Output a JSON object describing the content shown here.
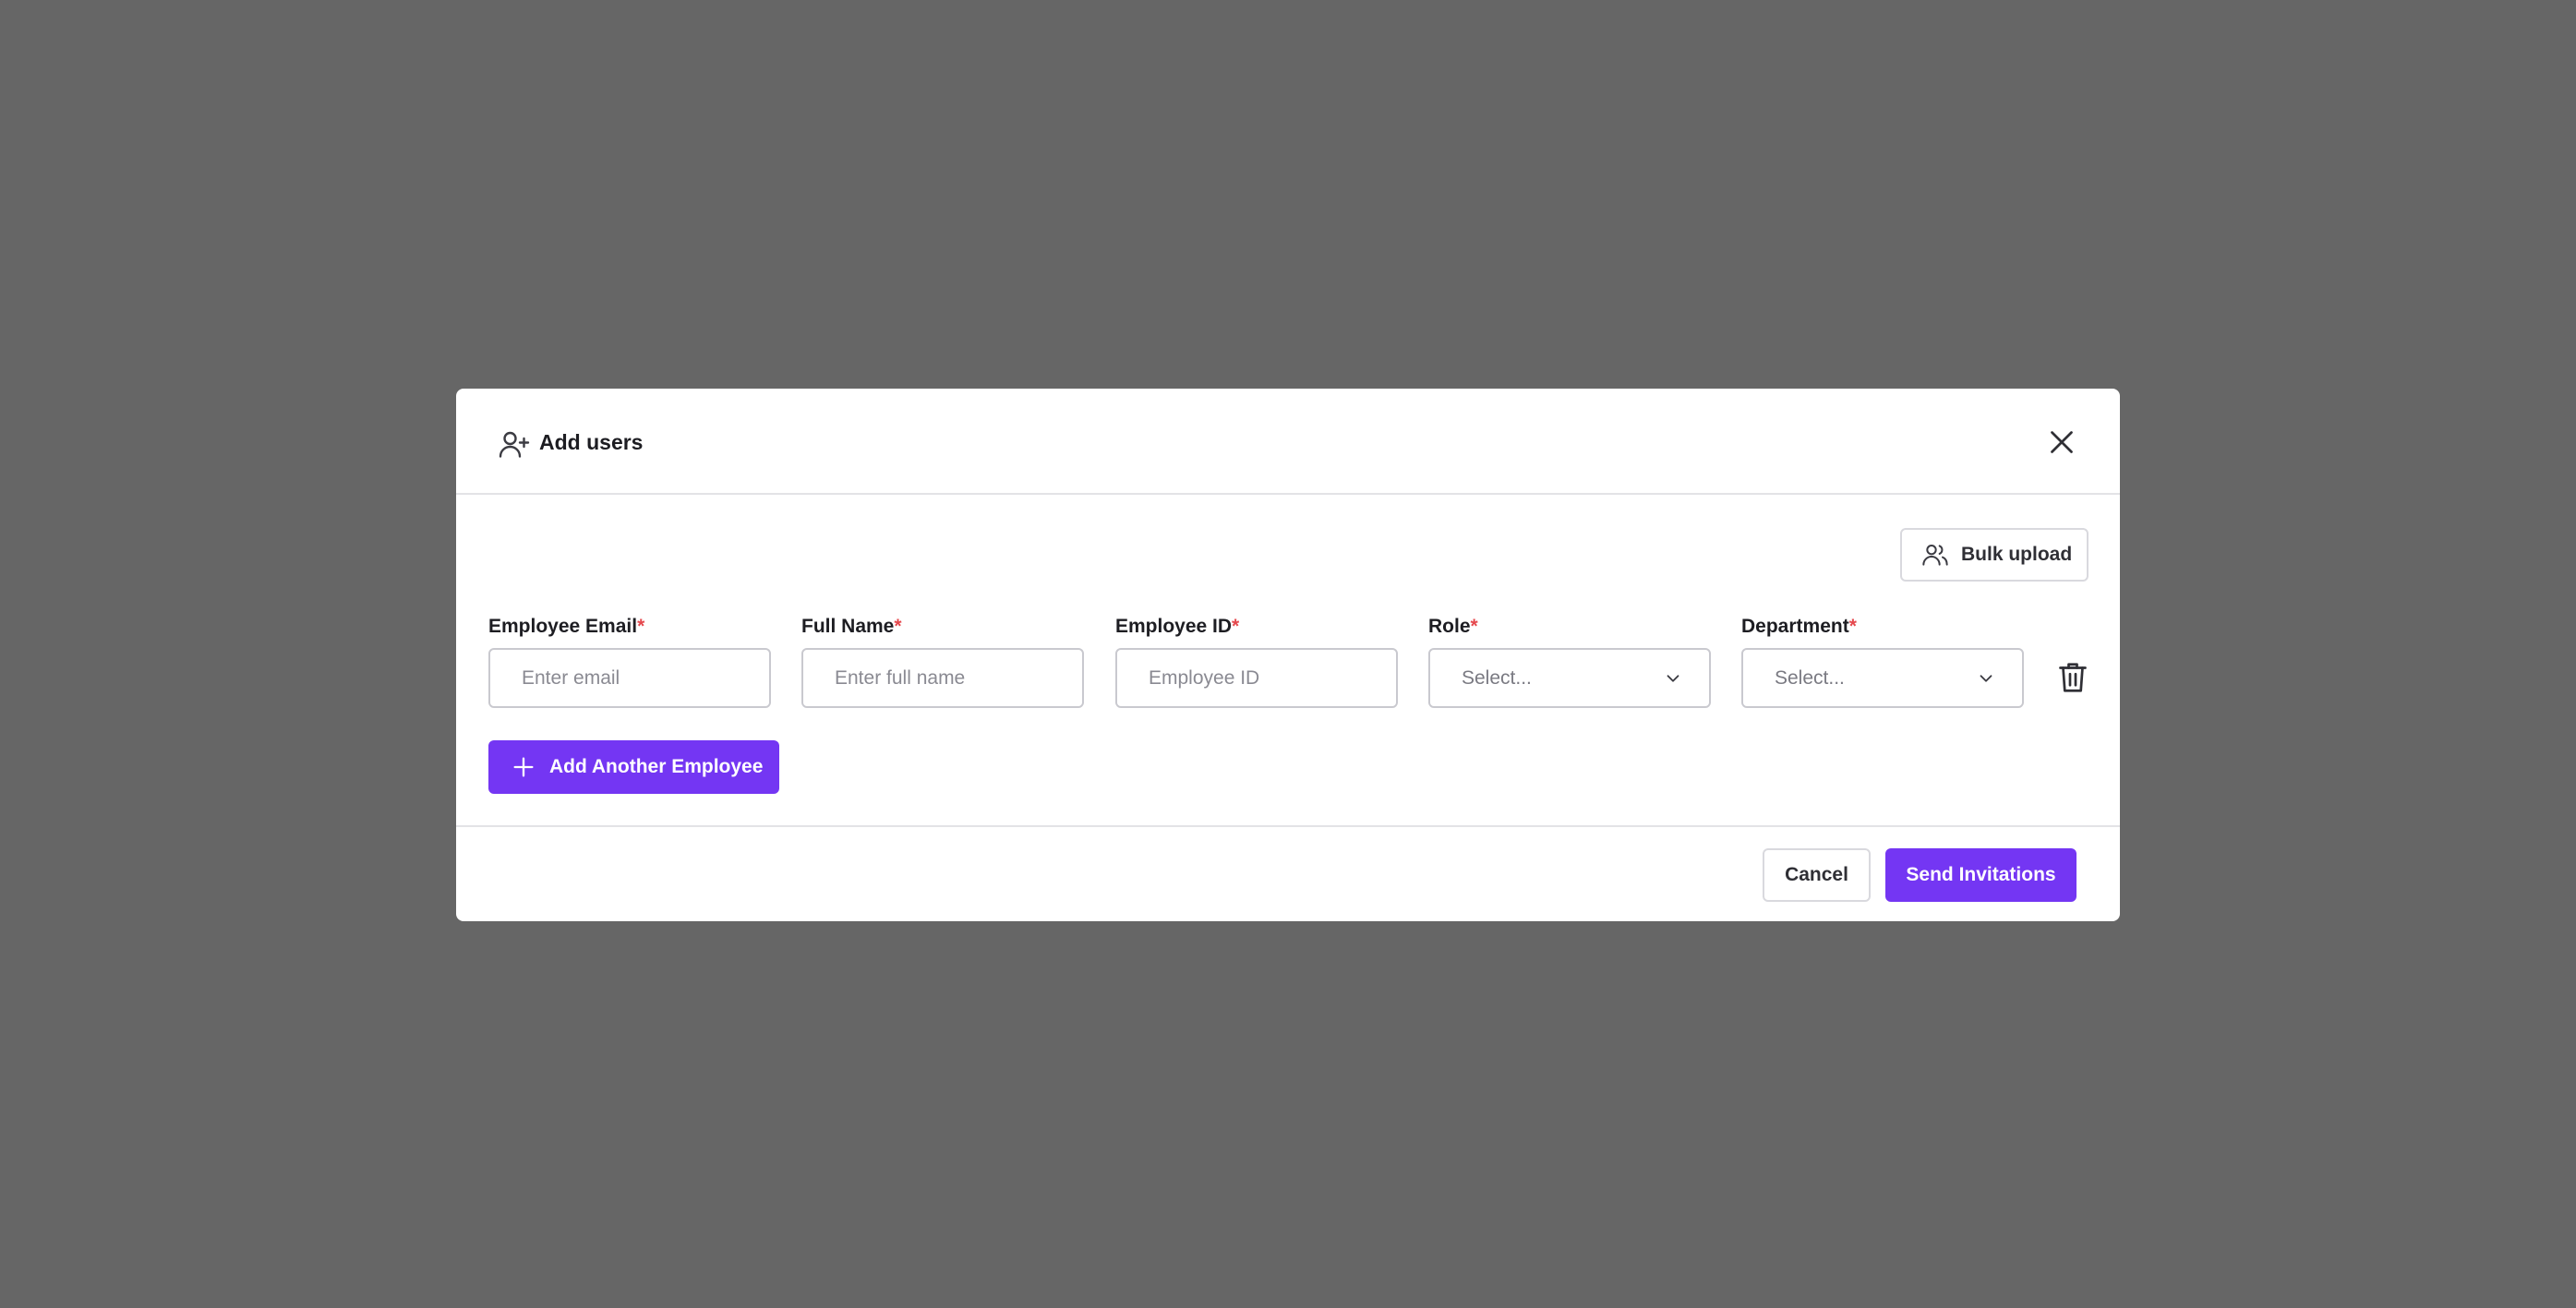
{
  "modal": {
    "title": "Add users",
    "bulk_upload_label": "Bulk upload",
    "required_marker": "*",
    "fields": {
      "email": {
        "label": "Employee Email",
        "placeholder": "Enter email"
      },
      "full_name": {
        "label": "Full Name",
        "placeholder": "Enter full name"
      },
      "employee_id": {
        "label": "Employee ID",
        "placeholder": "Employee ID"
      },
      "role": {
        "label": "Role",
        "selected": "Select..."
      },
      "department": {
        "label": "Department",
        "selected": "Select..."
      }
    },
    "add_another_label": "Add Another Employee",
    "footer": {
      "cancel_label": "Cancel",
      "send_label": "Send Invitations"
    }
  },
  "colors": {
    "primary": "#7436f3",
    "required": "#e5484d",
    "backdrop": "#666666"
  },
  "icons": {
    "header": "user-plus-icon",
    "close": "close-icon",
    "bulk": "users-icon",
    "chevron": "chevron-down-icon",
    "delete": "trash-icon",
    "add": "plus-icon"
  }
}
